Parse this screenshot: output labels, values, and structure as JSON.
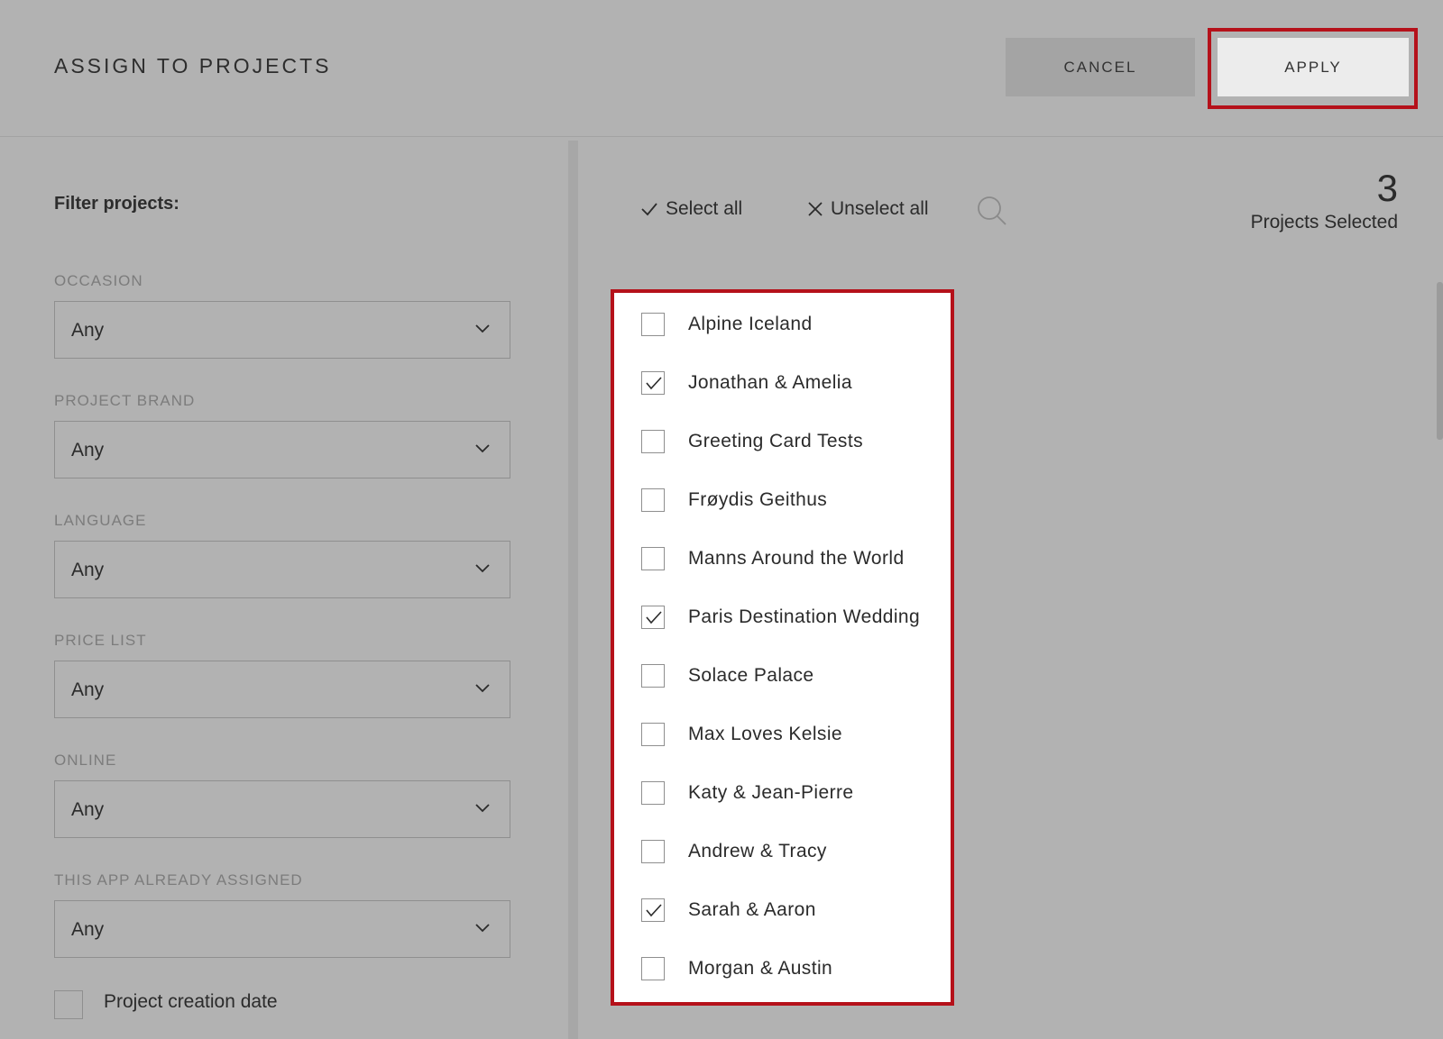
{
  "header": {
    "title": "ASSIGN TO PROJECTS",
    "cancel_label": "CANCEL",
    "apply_label": "APPLY"
  },
  "filters": {
    "title": "Filter projects:",
    "items": [
      {
        "label": "OCCASION",
        "value": "Any"
      },
      {
        "label": "PROJECT BRAND",
        "value": "Any"
      },
      {
        "label": "LANGUAGE",
        "value": "Any"
      },
      {
        "label": "PRICE LIST",
        "value": "Any"
      },
      {
        "label": "ONLINE",
        "value": "Any"
      },
      {
        "label": "THIS APP ALREADY ASSIGNED",
        "value": "Any"
      }
    ],
    "date_filter_label": "Project creation date"
  },
  "toolbar": {
    "select_all": "Select all",
    "unselect_all": "Unselect all"
  },
  "selection": {
    "count": "3",
    "label": "Projects Selected"
  },
  "projects": [
    {
      "name": "Alpine Iceland",
      "checked": false
    },
    {
      "name": "Jonathan & Amelia",
      "checked": true
    },
    {
      "name": "Greeting Card Tests",
      "checked": false
    },
    {
      "name": "Frøydis Geithus",
      "checked": false
    },
    {
      "name": "Manns Around the World",
      "checked": false
    },
    {
      "name": "Paris Destination Wedding",
      "checked": true
    },
    {
      "name": "Solace Palace",
      "checked": false
    },
    {
      "name": "Max Loves Kelsie",
      "checked": false
    },
    {
      "name": "Katy & Jean-Pierre",
      "checked": false
    },
    {
      "name": "Andrew & Tracy",
      "checked": false
    },
    {
      "name": "Sarah & Aaron",
      "checked": true
    },
    {
      "name": "Morgan & Austin",
      "checked": false
    }
  ],
  "colors": {
    "background": "#b2b2b2",
    "highlight": "#b5111a",
    "apply_bg": "#ececec",
    "cancel_bg": "#a4a4a4"
  }
}
